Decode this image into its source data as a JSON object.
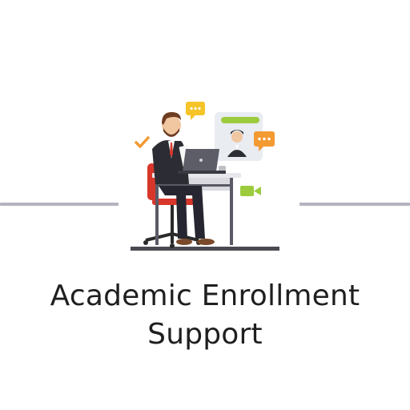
{
  "title": {
    "line1": "Academic Enrollment",
    "line2": "Support"
  },
  "illustration": {
    "icons": [
      "chat-bubble-icon",
      "video-call-icon",
      "checkmark-icon",
      "laptop-icon",
      "user-profile-card-icon"
    ]
  },
  "colors": {
    "background": "#ffffff",
    "divider": "#b6b2bf",
    "title_text": "#1f1f1f",
    "accent_yellow": "#f5c428",
    "accent_orange": "#f39a33",
    "accent_green": "#9ccc3d",
    "chair_red": "#d8362a",
    "suit_dark": "#2c2c34"
  }
}
